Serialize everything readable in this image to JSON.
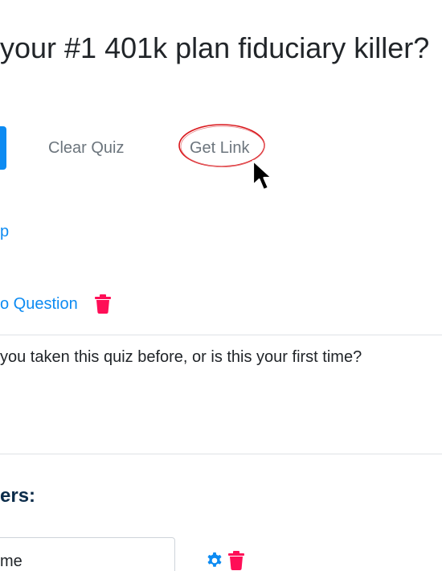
{
  "quiz": {
    "title": "your #1 401k plan fiduciary killer?"
  },
  "toolbar": {
    "clear_quiz_label": "Clear Quiz",
    "get_link_label": "Get Link"
  },
  "links": {
    "partial_link": "p",
    "question_link": "o Question"
  },
  "question": {
    "text": "you taken this quiz before, or is this your first time?"
  },
  "answers": {
    "heading": "ers:",
    "first_answer_value": "me"
  },
  "colors": {
    "accent_blue": "#0d8bf2",
    "danger_pink": "#ff0e57",
    "heading_navy": "#0b2c4a",
    "annotation_red": "#d9161b"
  },
  "icons": {
    "trash": "trash-icon",
    "gear": "gear-icon",
    "cursor": "mouse-pointer-icon"
  }
}
